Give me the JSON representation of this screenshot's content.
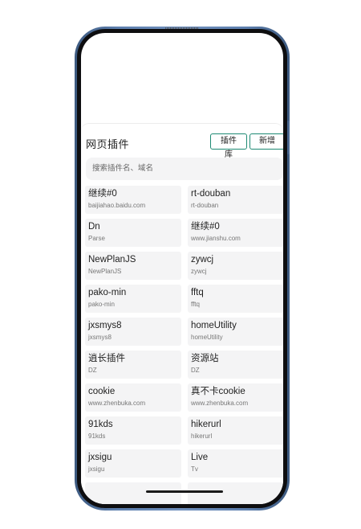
{
  "header": {
    "title": "网页插件",
    "library_label": "插件库",
    "new_label": "新增"
  },
  "search": {
    "placeholder": "搜索插件名、域名"
  },
  "plugins": [
    {
      "name": "继续#0",
      "domain": "baijiahao.baidu.com"
    },
    {
      "name": "rt-douban",
      "domain": "rt-douban"
    },
    {
      "name": "Dn",
      "domain": "Parse"
    },
    {
      "name": "继续#0",
      "domain": "www.jianshu.com"
    },
    {
      "name": "NewPlanJS",
      "domain": "NewPlanJS"
    },
    {
      "name": "zywcj",
      "domain": "zywcj"
    },
    {
      "name": "pako-min",
      "domain": "pako-min"
    },
    {
      "name": "fftq",
      "domain": "fftq"
    },
    {
      "name": "jxsmys8",
      "domain": "jxsmys8"
    },
    {
      "name": "homeUtility",
      "domain": "homeUtility"
    },
    {
      "name": "逍长插件",
      "domain": "DZ"
    },
    {
      "name": "资源站",
      "domain": "DZ"
    },
    {
      "name": "cookie",
      "domain": "www.zhenbuka.com"
    },
    {
      "name": "真不卡cookie",
      "domain": "www.zhenbuka.com"
    },
    {
      "name": "91kds",
      "domain": "91kds"
    },
    {
      "name": "hikerurl",
      "domain": "hikerurl"
    },
    {
      "name": "jxsigu",
      "domain": "jxsigu"
    },
    {
      "name": "Live",
      "domain": "Tv"
    },
    {
      "name": "",
      "domain": ""
    },
    {
      "name": "",
      "domain": ""
    }
  ],
  "colors": {
    "accent": "#1e8a73",
    "card_bg": "#f4f4f5",
    "frame": "#5d7fae"
  }
}
